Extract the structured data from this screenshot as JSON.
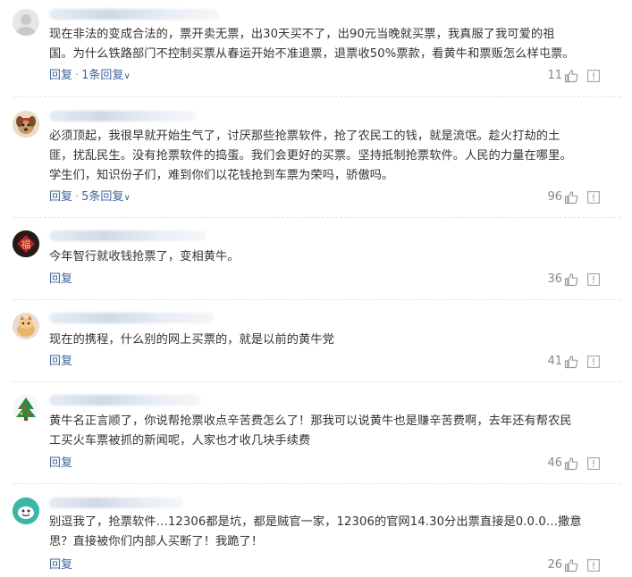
{
  "comments": [
    {
      "content": "现在非法的变成合法的，票开卖无票，出30天买不了，出90元当晚就买票，我真服了我可爱的祖\n国。为什么铁路部门不控制买票从春运开始不准退票，退票收50%票款，看黄牛和票贩怎么样屯票。",
      "reply": "回复",
      "reply_count": "1条回复",
      "likes": "11",
      "avatar_icon": "default-avatar-icon"
    },
    {
      "content": "必须顶起，我很早就开始生气了，讨厌那些抢票软件，抢了农民工的钱，就是流氓。趁火打劫的土\n匪，扰乱民生。没有抢票软件的捣蛋。我们会更好的买票。坚持抵制抢票软件。人民的力量在哪里。\n学生们，知识份子们，难到你们以花钱抢到车票为荣吗，骄傲吗。",
      "reply": "回复",
      "reply_count": "5条回复",
      "likes": "96",
      "avatar_icon": "dog-avatar-icon"
    },
    {
      "content": "今年智行就收钱抢票了，变相黄牛。",
      "reply": "回复",
      "likes": "36",
      "avatar_icon": "fu-avatar-icon"
    },
    {
      "content": "现在的携程，什么别的网上买票的，就是以前的黄牛党",
      "reply": "回复",
      "likes": "41",
      "avatar_icon": "cartoon-avatar-icon"
    },
    {
      "content": "黄牛名正言顺了，你说帮抢票收点辛苦费怎么了！那我可以说黄牛也是赚辛苦费啊，去年还有帮农民\n工买火车票被抓的新闻呢，人家也才收几块手续费",
      "reply": "回复",
      "likes": "46",
      "avatar_icon": "christmas-avatar-icon"
    },
    {
      "content": "别逗我了，抢票软件…12306都是坑，都是贼官一家，12306的官网14.30分出票直接是0.0.0…撒意\n思？直接被你们内部人买断了！我跪了！",
      "reply": "回复",
      "likes": "26",
      "avatar_icon": "smile-avatar-icon"
    }
  ],
  "colors": {
    "text": "#333333",
    "link": "#406599",
    "muted": "#888888"
  }
}
